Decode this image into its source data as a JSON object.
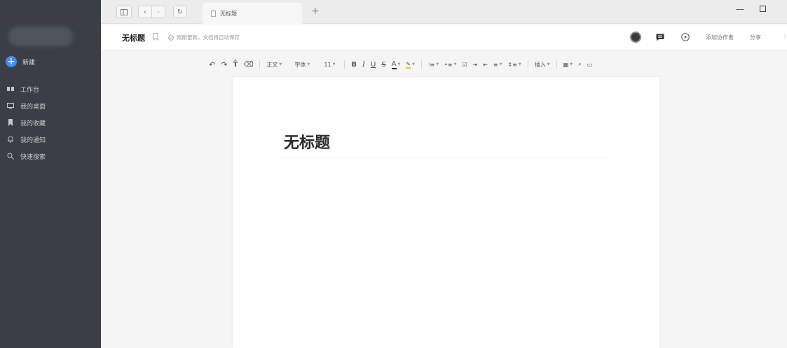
{
  "sidebar": {
    "new_label": "新建",
    "items": [
      {
        "label": "工作台",
        "icon": "workbench-icon"
      },
      {
        "label": "我的桌面",
        "icon": "desktop-icon"
      },
      {
        "label": "我的收藏",
        "icon": "bookmark-icon"
      },
      {
        "label": "我的通知",
        "icon": "bell-icon"
      },
      {
        "label": "快速搜索",
        "icon": "search-icon"
      }
    ]
  },
  "tab": {
    "label": "无标题"
  },
  "header": {
    "title": "无标题",
    "save_status": "刚刚更新，文档将自动保存",
    "add_collaborator": "添加协作者",
    "share": "分享"
  },
  "toolbar": {
    "paragraph_style": "正文",
    "font": "字体",
    "font_size": "11",
    "bold": "B",
    "italic": "I",
    "underline": "U",
    "strike": "S",
    "font_color": "A",
    "insert": "插入"
  },
  "document": {
    "title": "无标题"
  },
  "colors": {
    "accent": "#3d8ef0",
    "sidebar_bg": "#3b3f45",
    "page_bg": "#ffffff"
  }
}
